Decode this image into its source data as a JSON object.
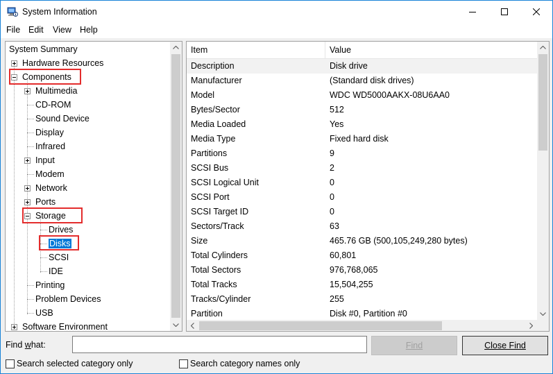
{
  "window": {
    "title": "System Information"
  },
  "menu": [
    "File",
    "Edit",
    "View",
    "Help"
  ],
  "tree": {
    "items": [
      {
        "label": "System Summary",
        "level": 0,
        "expander": "none"
      },
      {
        "label": "Hardware Resources",
        "level": 1,
        "expander": "plus"
      },
      {
        "label": "Components",
        "level": 1,
        "expander": "minus",
        "highlight": true
      },
      {
        "label": "Multimedia",
        "level": 2,
        "expander": "plus"
      },
      {
        "label": "CD-ROM",
        "level": 2,
        "expander": "none"
      },
      {
        "label": "Sound Device",
        "level": 2,
        "expander": "none"
      },
      {
        "label": "Display",
        "level": 2,
        "expander": "none"
      },
      {
        "label": "Infrared",
        "level": 2,
        "expander": "none"
      },
      {
        "label": "Input",
        "level": 2,
        "expander": "plus"
      },
      {
        "label": "Modem",
        "level": 2,
        "expander": "none"
      },
      {
        "label": "Network",
        "level": 2,
        "expander": "plus"
      },
      {
        "label": "Ports",
        "level": 2,
        "expander": "plus"
      },
      {
        "label": "Storage",
        "level": 2,
        "expander": "minus",
        "highlight": true
      },
      {
        "label": "Drives",
        "level": 3,
        "expander": "none"
      },
      {
        "label": "Disks",
        "level": 3,
        "expander": "none",
        "selected": true,
        "highlight": true
      },
      {
        "label": "SCSI",
        "level": 3,
        "expander": "none"
      },
      {
        "label": "IDE",
        "level": 3,
        "expander": "none"
      },
      {
        "label": "Printing",
        "level": 2,
        "expander": "none"
      },
      {
        "label": "Problem Devices",
        "level": 2,
        "expander": "none"
      },
      {
        "label": "USB",
        "level": 2,
        "expander": "none"
      },
      {
        "label": "Software Environment",
        "level": 1,
        "expander": "plus"
      }
    ]
  },
  "list": {
    "columns": [
      "Item",
      "Value"
    ],
    "rows": [
      [
        "Description",
        "Disk drive"
      ],
      [
        "Manufacturer",
        "(Standard disk drives)"
      ],
      [
        "Model",
        "WDC WD5000AAKX-08U6AA0"
      ],
      [
        "Bytes/Sector",
        "512"
      ],
      [
        "Media Loaded",
        "Yes"
      ],
      [
        "Media Type",
        "Fixed hard disk"
      ],
      [
        "Partitions",
        "9"
      ],
      [
        "SCSI Bus",
        "2"
      ],
      [
        "SCSI Logical Unit",
        "0"
      ],
      [
        "SCSI Port",
        "0"
      ],
      [
        "SCSI Target ID",
        "0"
      ],
      [
        "Sectors/Track",
        "63"
      ],
      [
        "Size",
        "465.76 GB (500,105,249,280 bytes)"
      ],
      [
        "Total Cylinders",
        "60,801"
      ],
      [
        "Total Sectors",
        "976,768,065"
      ],
      [
        "Total Tracks",
        "15,504,255"
      ],
      [
        "Tracks/Cylinder",
        "255"
      ],
      [
        "Partition",
        "Disk #0, Partition #0"
      ]
    ]
  },
  "find": {
    "label_prefix": "Find ",
    "label_accel": "w",
    "label_suffix": "hat:",
    "value": "",
    "find_button": "Find",
    "close_find_button": "Close Find",
    "search_selected": "Search selected category only",
    "search_names": "Search category names only"
  },
  "colors": {
    "selection": "#0078d7",
    "highlight_box": "#e32c2c",
    "title_accent": "#1883d7"
  }
}
